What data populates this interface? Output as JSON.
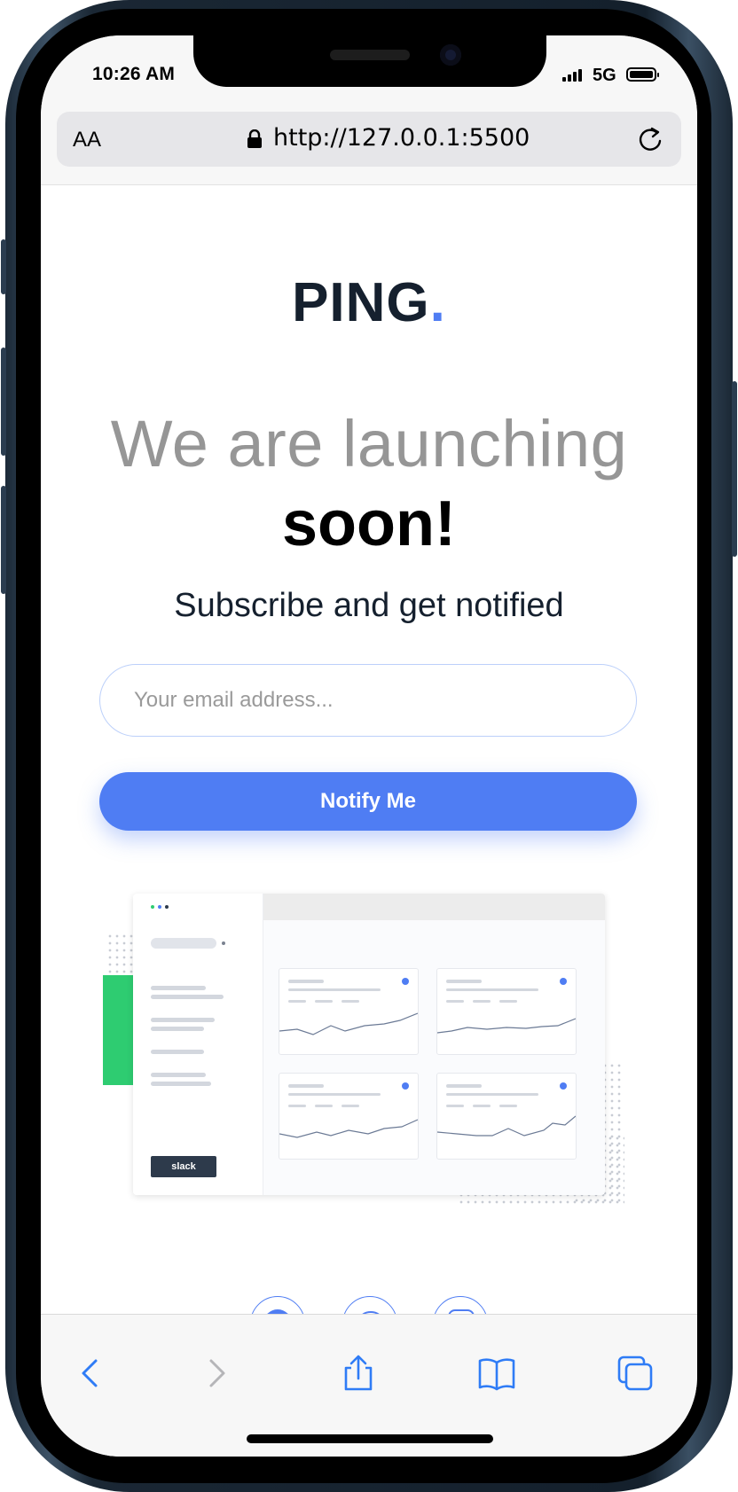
{
  "status_bar": {
    "time": "10:26 AM",
    "network": "5G"
  },
  "browser": {
    "text_size_label": "AA",
    "url": "http://127.0.0.1:5500"
  },
  "page": {
    "logo": "PING",
    "logo_dot": ".",
    "headline_light": "We are launching",
    "headline_bold": "soon!",
    "subtitle": "Subscribe and get notified",
    "email_placeholder": "Your email address...",
    "notify_button": "Notify Me",
    "illustration": {
      "slack_label": "slack"
    }
  },
  "colors": {
    "accent": "#4f7df3",
    "logo_text": "#15202e",
    "headline_light": "#969696",
    "green": "#2ecc71"
  },
  "icons": {
    "lock": "lock-icon",
    "reload": "reload-icon",
    "back": "chevron-left-icon",
    "forward": "chevron-right-icon",
    "share": "share-icon",
    "bookmarks": "book-icon",
    "tabs": "tabs-icon"
  }
}
